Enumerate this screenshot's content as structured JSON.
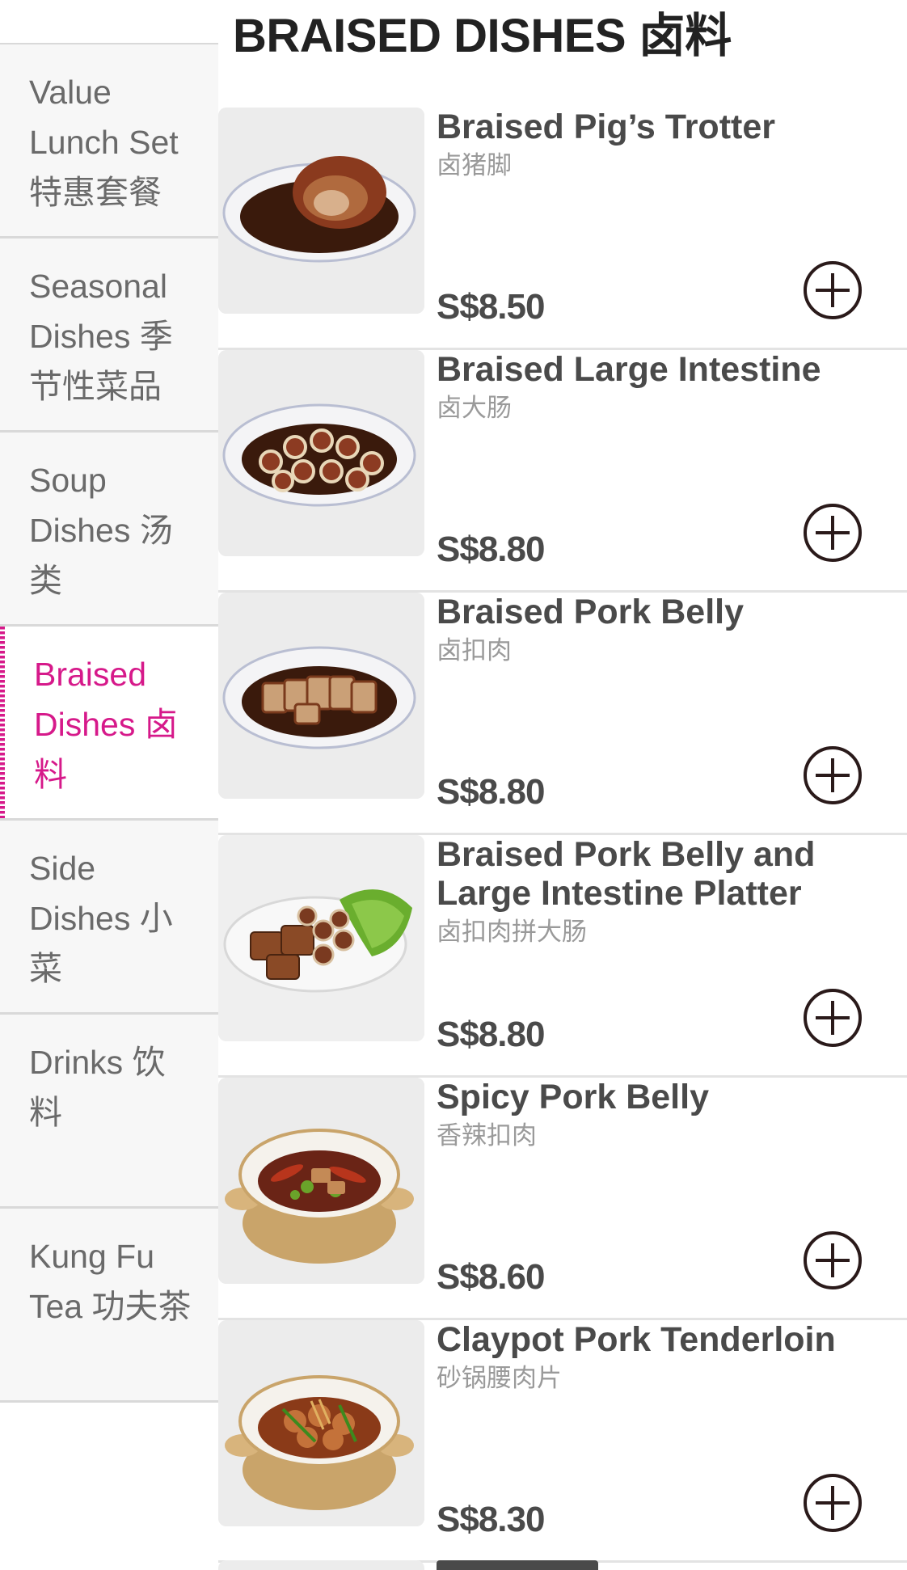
{
  "sidebar": {
    "categories": [
      {
        "label": "Value Lunch Set 特惠套餐",
        "lines": [
          "Value",
          "Lunch Set",
          "特惠套餐"
        ],
        "active": false
      },
      {
        "label": "Seasonal Dishes 季节性菜品",
        "lines": [
          "Seasonal",
          "Dishes 季",
          "节性菜品"
        ],
        "active": false
      },
      {
        "label": "Soup Dishes 汤类",
        "lines": [
          "Soup",
          "Dishes 汤",
          "类"
        ],
        "active": false
      },
      {
        "label": "Braised Dishes 卤料",
        "lines": [
          "Braised",
          "Dishes 卤",
          "料"
        ],
        "active": true
      },
      {
        "label": "Side Dishes 小菜",
        "lines": [
          "Side",
          "Dishes 小",
          "菜"
        ],
        "active": false
      },
      {
        "label": "Drinks 饮料",
        "lines": [
          "Drinks 饮",
          "料"
        ],
        "active": false
      },
      {
        "label": "Kung Fu Tea 功夫茶",
        "lines": [
          "Kung Fu",
          "Tea 功夫茶"
        ],
        "active": false
      }
    ],
    "active_color": "#d6198a"
  },
  "main": {
    "section_title": "BRAISED DISHES 卤料",
    "items": [
      {
        "name_lines": [
          "Braised Pig’s Trotter"
        ],
        "chinese": "卤猪脚",
        "price": "S$8.50",
        "image": "pigs-trotter-plate"
      },
      {
        "name_lines": [
          "Braised Large Intestine"
        ],
        "chinese": "卤大肠",
        "price": "S$8.80",
        "image": "large-intestine-plate"
      },
      {
        "name_lines": [
          "Braised Pork Belly"
        ],
        "chinese": "卤扣肉",
        "price": "S$8.80",
        "image": "pork-belly-plate"
      },
      {
        "name_lines": [
          "Braised Pork Belly and",
          "Large Intestine Platter"
        ],
        "chinese": "卤扣肉拼大肠",
        "price": "S$8.80",
        "image": "pork-belly-intestine-platter"
      },
      {
        "name_lines": [
          "Spicy Pork Belly"
        ],
        "chinese": "香辣扣肉",
        "price": "S$8.60",
        "image": "spicy-pork-belly-claypot"
      },
      {
        "name_lines": [
          "Claypot Pork Tenderloin"
        ],
        "chinese": "砂锅腰肉片",
        "price": "S$8.30",
        "image": "claypot-pork-tenderloin"
      }
    ]
  }
}
